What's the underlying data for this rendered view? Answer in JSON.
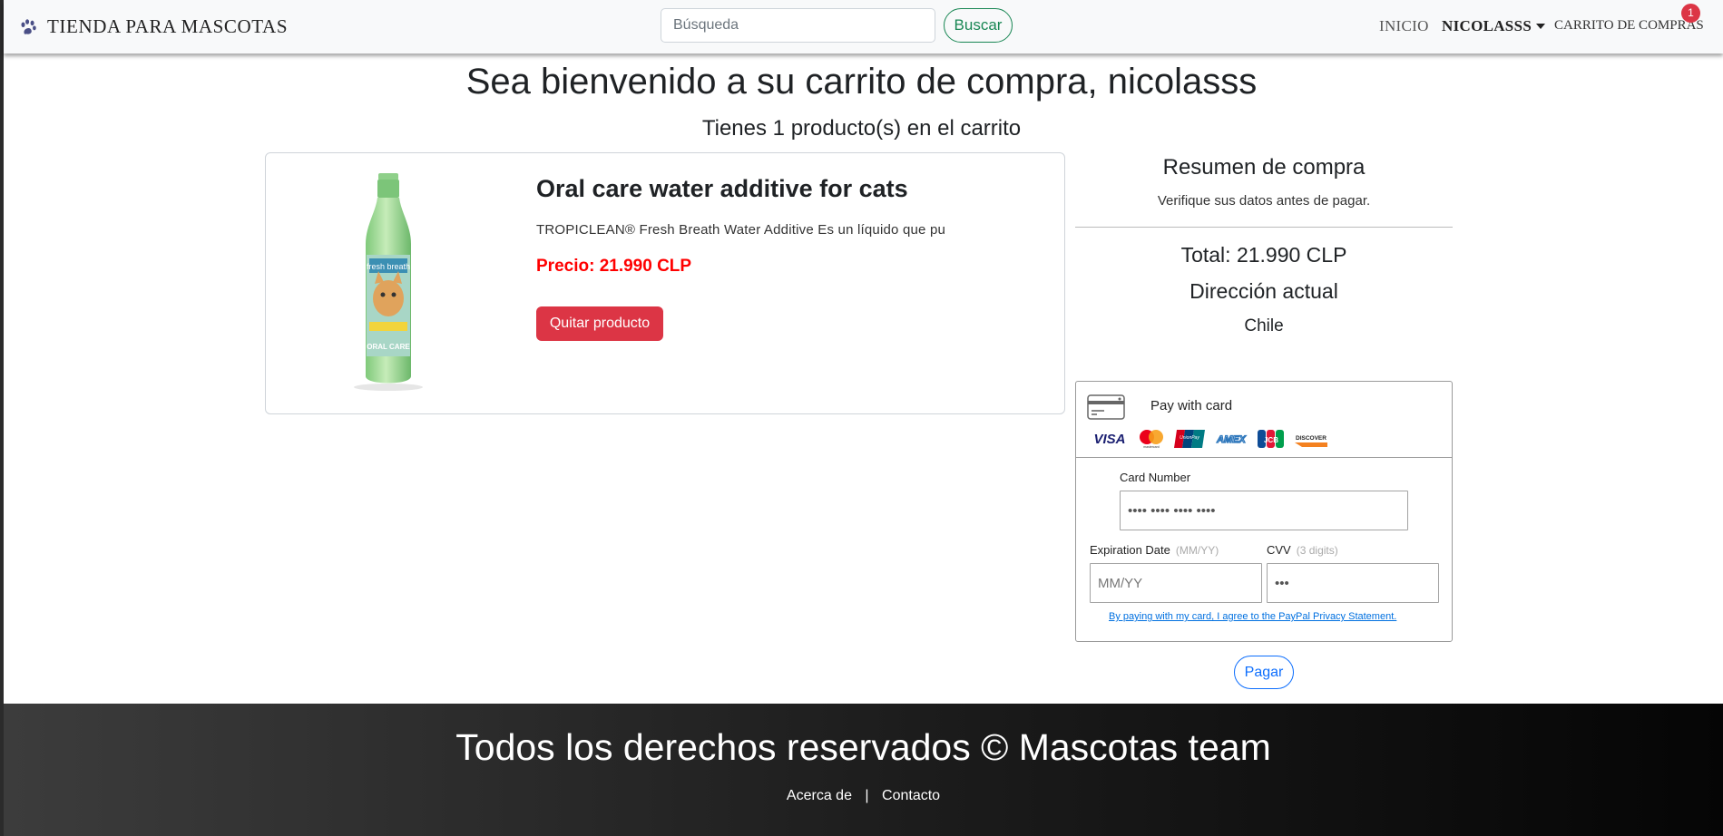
{
  "navbar": {
    "brand": "TIENDA PARA MASCOTAS",
    "search_placeholder": "Búsqueda",
    "search_button": "Buscar",
    "inicio": "INICIO",
    "user": "NICOLASSS",
    "cart": "CARRITO DE COMPRAS",
    "cart_count": "1"
  },
  "main": {
    "welcome": "Sea bienvenido a su carrito de compra, nicolasss",
    "count_text": "Tienes 1 producto(s) en el carrito"
  },
  "product": {
    "title": "Oral care water additive for cats",
    "description": "TROPICLEAN® Fresh Breath Water Additive Es un líquido que pu",
    "price": "Precio: 21.990 CLP",
    "remove_button": "Quitar producto",
    "bottle_label_top": "fresh breath",
    "bottle_label_bottom": "ORAL CARE"
  },
  "summary": {
    "title": "Resumen de compra",
    "subtitle": "Verifique sus datos antes de pagar.",
    "total": "Total: 21.990 CLP",
    "address_title": "Dirección actual",
    "address_value": "Chile"
  },
  "payment": {
    "heading": "Pay with card",
    "logos": [
      "VISA",
      "mastercard",
      "UnionPay",
      "AMEX",
      "JCB",
      "DISCOVER"
    ],
    "card_number_label": "Card Number",
    "card_number_placeholder": "•••• •••• •••• ••••",
    "expiration_label": "Expiration Date",
    "expiration_hint": "(MM/YY)",
    "expiration_placeholder": "MM/YY",
    "cvv_label": "CVV",
    "cvv_hint": "(3 digits)",
    "cvv_placeholder": "•••",
    "privacy_text": "By paying with my card, I agree to the PayPal Privacy Statement.",
    "pay_button": "Pagar"
  },
  "footer": {
    "title": "Todos los derechos reservados © Mascotas team",
    "about": "Acerca de",
    "separator": "|",
    "contact": "Contacto"
  },
  "colors": {
    "danger": "#dc3545",
    "success": "#198754",
    "primary": "#0d6efd",
    "price": "#ff0000"
  }
}
